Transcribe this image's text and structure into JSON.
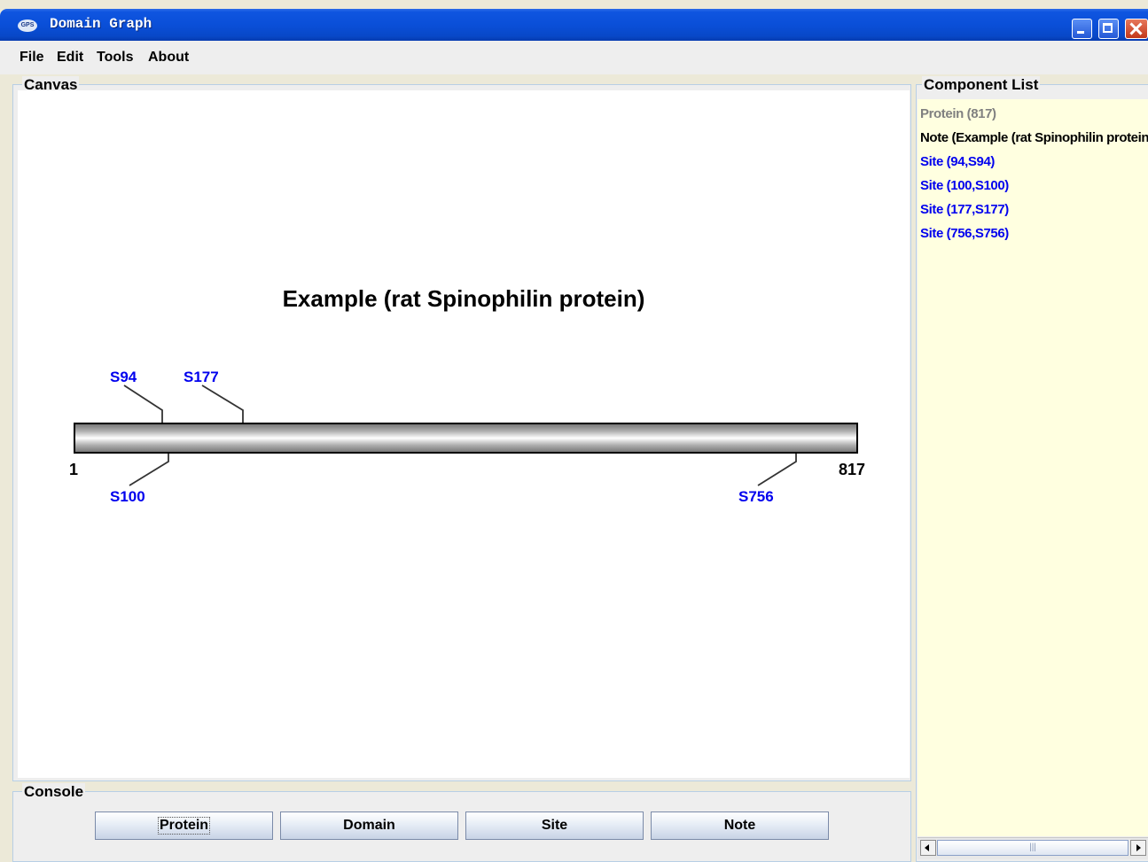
{
  "window": {
    "title": "Domain Graph",
    "icon_text": "GPS"
  },
  "menu": {
    "items": [
      "File",
      "Edit",
      "Tools",
      "About"
    ]
  },
  "canvas": {
    "panel_title": "Canvas",
    "graph_title": "Example  (rat Spinophilin protein)",
    "protein_start": "1",
    "protein_end": "817",
    "sites": [
      {
        "label": "S94",
        "position": 94
      },
      {
        "label": "S100",
        "position": 100
      },
      {
        "label": "S177",
        "position": 177
      },
      {
        "label": "S756",
        "position": 756
      }
    ]
  },
  "console": {
    "panel_title": "Console",
    "buttons": [
      "Protein",
      "Domain",
      "Site",
      "Note"
    ]
  },
  "component_list": {
    "panel_title": "Component List",
    "items": [
      {
        "text": "Protein (817)",
        "color": "#808080"
      },
      {
        "text": "Note (Example (rat Spinophilin protein))",
        "color": "#000000"
      },
      {
        "text": "Site (94,S94)",
        "color": "#0000ee"
      },
      {
        "text": "Site (100,S100)",
        "color": "#0000ee"
      },
      {
        "text": "Site (177,S177)",
        "color": "#0000ee"
      },
      {
        "text": "Site (756,S756)",
        "color": "#0000ee"
      }
    ],
    "scroll_thumb_grip": "|||"
  }
}
